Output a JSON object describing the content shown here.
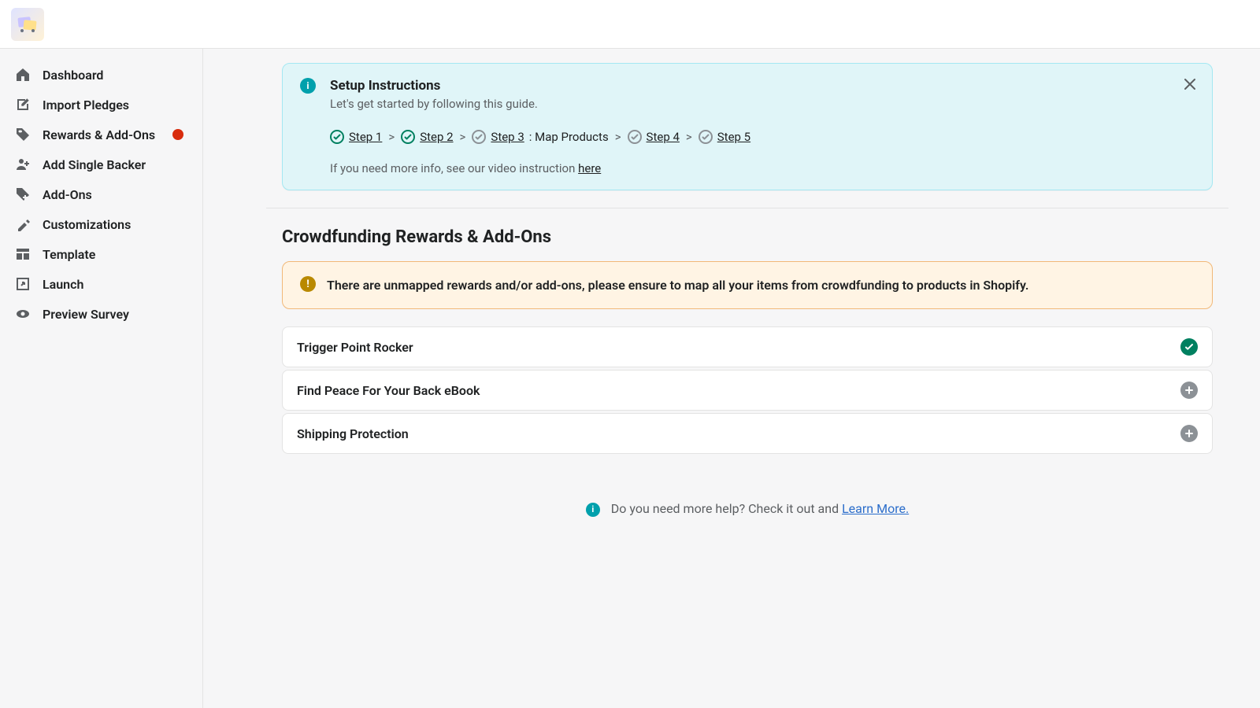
{
  "sidebar": {
    "items": [
      {
        "label": "Dashboard",
        "icon": "home"
      },
      {
        "label": "Import Pledges",
        "icon": "edit"
      },
      {
        "label": "Rewards & Add-Ons",
        "icon": "tag",
        "badge": true
      },
      {
        "label": "Add Single Backer",
        "icon": "user-plus"
      },
      {
        "label": "Add-Ons",
        "icon": "addon"
      },
      {
        "label": "Customizations",
        "icon": "paint"
      },
      {
        "label": "Template",
        "icon": "template"
      },
      {
        "label": "Launch",
        "icon": "launch"
      },
      {
        "label": "Preview Survey",
        "icon": "eye"
      }
    ]
  },
  "setup": {
    "title": "Setup Instructions",
    "subtitle": "Let's get started by following this guide.",
    "steps": [
      {
        "label": "Step 1",
        "done": true
      },
      {
        "label": "Step 2",
        "done": true
      },
      {
        "label": "Step 3",
        "done": false,
        "suffix": ": Map Products"
      },
      {
        "label": "Step 4",
        "done": false
      },
      {
        "label": "Step 5",
        "done": false
      }
    ],
    "video_prefix": "If you need more info, see our video instruction ",
    "video_link": "here"
  },
  "page": {
    "title": "Crowdfunding Rewards & Add-Ons"
  },
  "warning": {
    "text": "There are unmapped rewards and/or add-ons, please ensure to map all your items from crowdfunding to products in Shopify."
  },
  "rewards": [
    {
      "name": "Trigger Point Rocker",
      "status": "mapped"
    },
    {
      "name": "Find Peace For Your Back eBook",
      "status": "unmapped"
    },
    {
      "name": "Shipping Protection",
      "status": "unmapped"
    }
  ],
  "help": {
    "prefix": "Do you need more help? Check it out and ",
    "link": "Learn More."
  }
}
